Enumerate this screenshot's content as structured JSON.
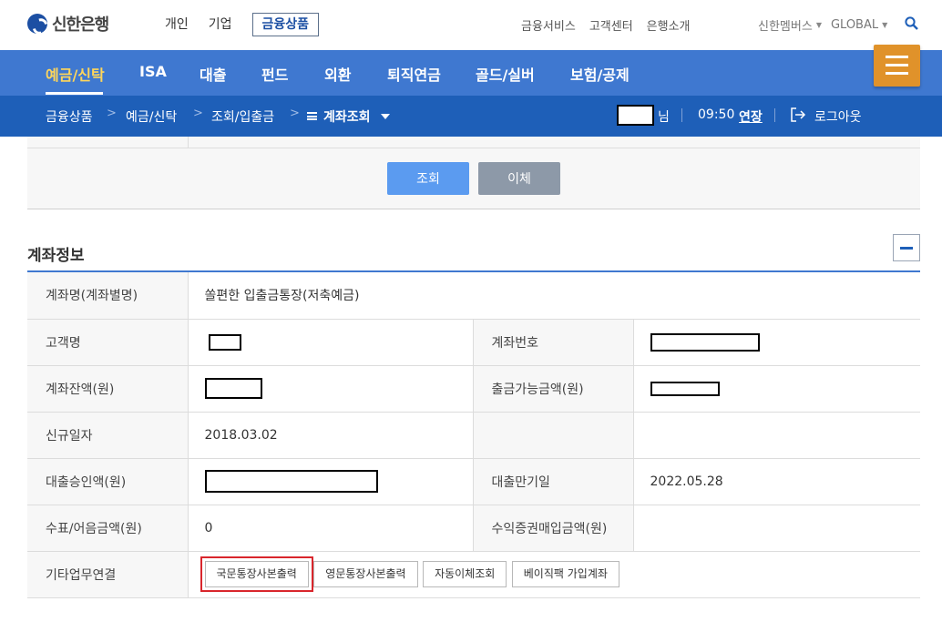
{
  "header": {
    "logo_text": "신한은행",
    "tabs": [
      "개인",
      "기업",
      "금융상품"
    ],
    "util_links": [
      "금융서비스",
      "고객센터",
      "은행소개"
    ],
    "member_label": "신한멤버스",
    "global_label": "GLOBAL"
  },
  "nav": {
    "items": [
      "예금/신탁",
      "ISA",
      "대출",
      "펀드",
      "외환",
      "퇴직연금",
      "골드/실버",
      "보험/공제"
    ]
  },
  "breadcrumb": {
    "items": [
      "금융상품",
      "예금/신탁",
      "조회/입출금"
    ],
    "current": "계좌조회",
    "user_suffix": "님",
    "timer": "09:50",
    "extend": "연장",
    "logout": "로그아웃"
  },
  "search_panel": {
    "search_button": "조회",
    "transfer_button": "이체"
  },
  "account_info": {
    "title": "계좌정보",
    "rows": {
      "account_name_label": "계좌명(계좌별명)",
      "account_name_value": "쏠편한 입출금통장(저축예금)",
      "customer_label": "고객명",
      "account_number_label": "계좌번호",
      "balance_label": "계좌잔액(원)",
      "withdrawable_label": "출금가능금액(원)",
      "opened_label": "신규일자",
      "opened_value": "2018.03.02",
      "loan_approved_label": "대출승인액(원)",
      "loan_due_label": "대출만기일",
      "loan_due_value": "2022.05.28",
      "check_amount_label": "수표/어음금액(원)",
      "check_amount_value": "0",
      "securities_label": "수익증권매입금액(원)",
      "other_label": "기타업무연결"
    },
    "actions": [
      "국문통장사본출력",
      "영문통장사본출력",
      "자동이체조회",
      "베이직팩 가입계좌"
    ]
  }
}
